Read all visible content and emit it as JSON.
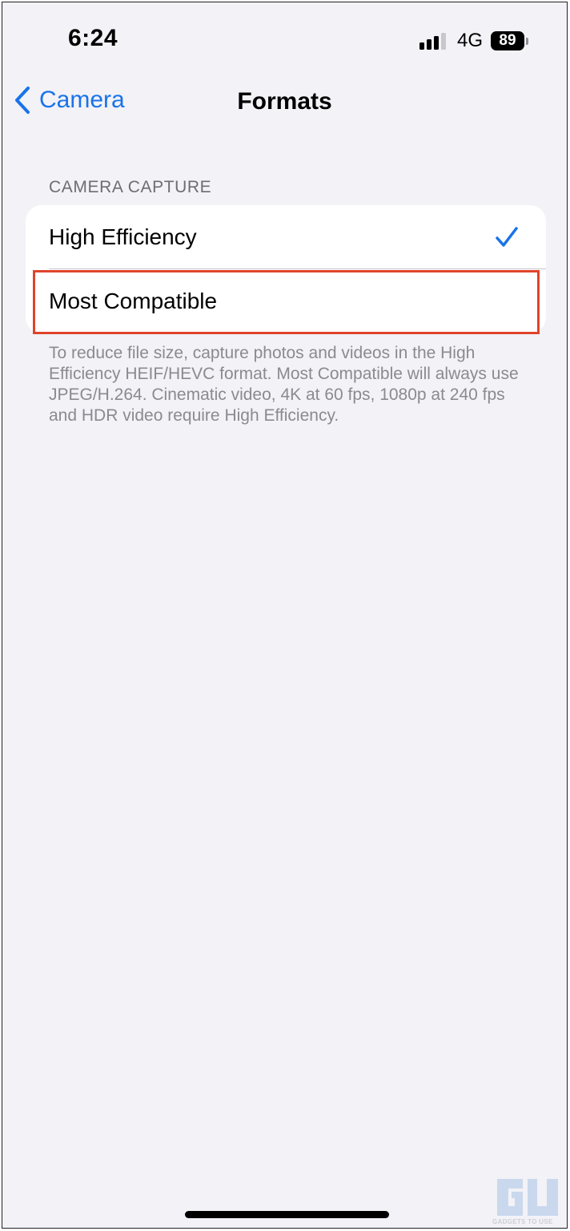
{
  "status_bar": {
    "time": "6:24",
    "network": "4G",
    "battery": "89",
    "signal_bars": 4
  },
  "nav": {
    "back_label": "Camera",
    "title": "Formats"
  },
  "section": {
    "header": "CAMERA CAPTURE",
    "options": [
      {
        "label": "High Efficiency",
        "selected": true
      },
      {
        "label": "Most Compatible",
        "selected": false
      }
    ],
    "footer": "To reduce file size, capture photos and videos in the High Efficiency HEIF/HEVC format. Most Compatible will always use JPEG/H.264. Cinematic video, 4K at 60 fps, 1080p at 240 fps and HDR video require High Efficiency."
  },
  "watermark": {
    "text": "GADGETS TO USE"
  },
  "colors": {
    "accent": "#1a73e8",
    "background": "#f2f2f7",
    "highlight_box": "#e0442b"
  },
  "icons": {
    "back": "chevron-left-icon",
    "check": "checkmark-icon",
    "signal": "cellular-signal-icon",
    "battery": "battery-icon"
  }
}
